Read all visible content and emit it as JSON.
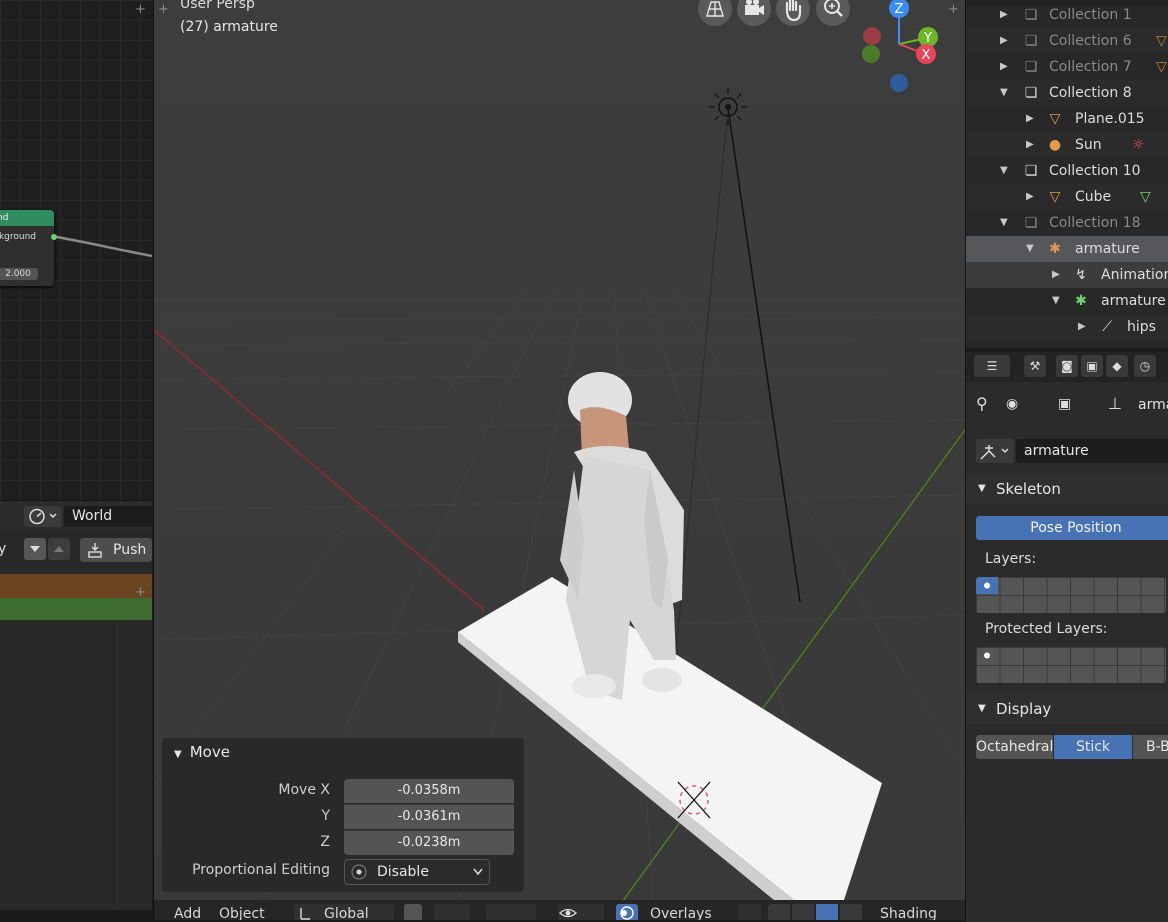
{
  "viewport": {
    "title": "User Persp",
    "object_label": "(27) armature",
    "move_panel": {
      "title": "Move",
      "fields": [
        {
          "label": "Move X",
          "value": "-0.0358m"
        },
        {
          "label": "Y",
          "value": "-0.0361m"
        },
        {
          "label": "Z",
          "value": "-0.0238m"
        }
      ],
      "proportional_label": "Proportional Editing",
      "proportional_value": "Disable"
    },
    "header": {
      "add": "Add",
      "object": "Object",
      "orientation": "Global",
      "overlays": "Overlays",
      "shading": "Shading"
    },
    "gizmo": {
      "z": "Z",
      "y": "Y",
      "x": "X"
    }
  },
  "node_editor": {
    "node_header": "nd",
    "node_socket": "ckground",
    "node_value": "2.000"
  },
  "left_lower": {
    "world": "World",
    "push": "Push"
  },
  "outliner": {
    "rows": [
      {
        "label": "Collection 1",
        "indent": 1
      },
      {
        "label": "Collection 6",
        "indent": 1
      },
      {
        "label": "Collection 7",
        "indent": 1
      },
      {
        "label": "Collection 8",
        "indent": 1
      },
      {
        "label": "Plane.015",
        "indent": 2
      },
      {
        "label": "Sun",
        "indent": 2
      },
      {
        "label": "Collection 10",
        "indent": 1
      },
      {
        "label": "Cube",
        "indent": 2
      },
      {
        "label": "Collection 18",
        "indent": 1
      },
      {
        "label": "armature",
        "indent": 2
      },
      {
        "label": "Animation",
        "indent": 3
      },
      {
        "label": "armature",
        "indent": 3
      },
      {
        "label": "hips",
        "indent": 4
      }
    ]
  },
  "properties": {
    "breadcrumb": "arma",
    "data_name": "armature",
    "skeleton_title": "Skeleton",
    "pose_position": "Pose Position",
    "layers_label": "Layers:",
    "protected_label": "Protected Layers:",
    "display_title": "Display",
    "display_options": [
      "Octahedral",
      "Stick",
      "B-B"
    ],
    "display_selected": "Stick"
  },
  "colors": {
    "accent_blue": "#4772b3",
    "axis_x": "#e8455a",
    "axis_y": "#6fb52a",
    "axis_z": "#3b8cf0"
  }
}
